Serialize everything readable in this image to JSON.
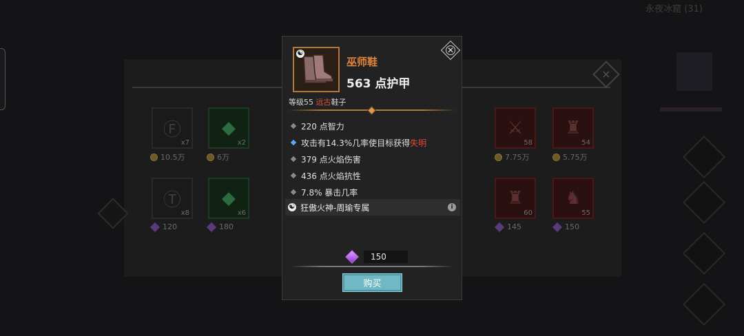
{
  "background": {
    "top_right_text": "永夜冰窟 (31)",
    "close_label": "×",
    "grid_items_row1": [
      {
        "qty": "x7",
        "price": "10.5万",
        "currency": "coin",
        "tone": "dark",
        "icon": "rune-icon"
      },
      {
        "qty": "x2",
        "price": "6万",
        "currency": "coin",
        "tone": "green",
        "icon": "green-gem-icon"
      },
      {
        "qty": "58",
        "price": "7.75万",
        "currency": "coin",
        "tone": "red",
        "icon": "axe-icon"
      },
      {
        "qty": "54",
        "price": "5.75万",
        "currency": "coin",
        "tone": "red",
        "icon": "robe-icon"
      }
    ],
    "grid_items_row2": [
      {
        "qty": "x8",
        "price": "120",
        "currency": "gem",
        "tone": "dark",
        "icon": "rune-icon"
      },
      {
        "qty": "x6",
        "price": "180",
        "currency": "gem",
        "tone": "green",
        "icon": "green-gem-icon"
      },
      {
        "qty": "60",
        "price": "145",
        "currency": "gem",
        "tone": "red",
        "icon": "armor-icon"
      },
      {
        "qty": "55",
        "price": "150",
        "currency": "gem",
        "tone": "red",
        "icon": "boots-icon"
      }
    ]
  },
  "tooltip": {
    "item_name": "巫师鞋",
    "armor": "563 点护甲",
    "level_prefix": "等级55 ",
    "rarity": "远古",
    "item_type": "鞋子",
    "yin_yang_glyph": "☯",
    "close_glyph": "✕",
    "stats": [
      {
        "text": "220 点智力",
        "bullet": "grey"
      },
      {
        "text_before": "攻击有14.3%几率使目标获得",
        "text_highlight": "失明",
        "bullet": "blue"
      },
      {
        "text": "379 点火焰伤害",
        "bullet": "grey"
      },
      {
        "text": "436 点火焰抗性",
        "bullet": "grey"
      },
      {
        "text": "7.8% 暴击几率",
        "bullet": "grey"
      }
    ],
    "set_bonus": "狂傲火神-周瑜专属",
    "info_glyph": "i",
    "price": "150",
    "currency_icon": "purple-gem-icon",
    "buy_label": "购买"
  },
  "colors": {
    "item_name": "#e0843a",
    "rarity": "#e0533a",
    "buy_button": "#6fb8c4",
    "frame": "#b07a3c"
  }
}
